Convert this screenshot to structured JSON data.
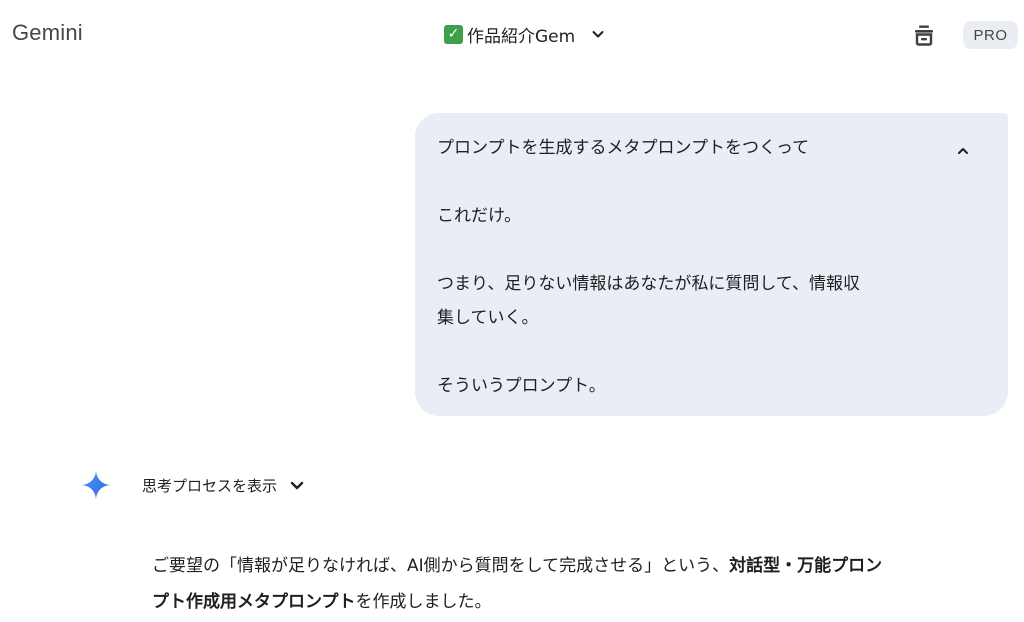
{
  "header": {
    "app_title": "Gemini",
    "gem_check_icon": "✅",
    "gem_name": "作品紹介Gem",
    "share_icon": "share-icon",
    "plan_badge": "PRO"
  },
  "user_message": {
    "lines": [
      "プロンプトを生成するメタプロンプトをつくって",
      "",
      "これだけ。",
      "",
      "つまり、足りない情報はあなたが私に質問して、情報収",
      "集していく。",
      "",
      "そういうプロンプト。"
    ],
    "collapse_icon": "chevron-up-icon"
  },
  "model_response": {
    "thinking_toggle_label": "思考プロセスを表示",
    "spark_icon": "gemini-spark-icon",
    "text_segments": {
      "part1": "ご要望の「情報が足りなければ、AI側から質問をして完成させる」という、",
      "part2_bold": "対話型・万能プロン",
      "part3_bold": "プト作成用メタプロンプト",
      "part4": "を作成しました。"
    }
  },
  "colors": {
    "user_bubble_bg": "#e9eef6",
    "badge_bg": "#eaeef3",
    "spark_blue": "#4285f4"
  }
}
